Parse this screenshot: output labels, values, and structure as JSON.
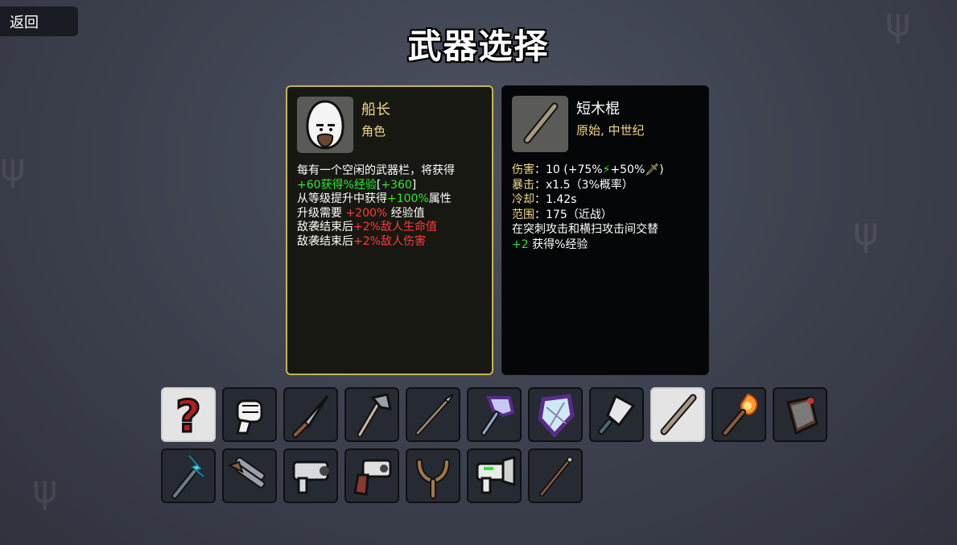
{
  "back_label": "返回",
  "title": "武器选择",
  "character": {
    "name": "船长",
    "type": "角色",
    "lines": [
      [
        {
          "t": "每有一个空闲的武器栏，将获得",
          "c": "w"
        }
      ],
      [
        {
          "t": "+60获得%经验",
          "c": "g"
        },
        {
          "t": "[",
          "c": "w"
        },
        {
          "t": "+360",
          "c": "g"
        },
        {
          "t": "]",
          "c": "w"
        }
      ],
      [
        {
          "t": "从等级提升中获得",
          "c": "w"
        },
        {
          "t": "+100%",
          "c": "g"
        },
        {
          "t": "属性",
          "c": "w"
        }
      ],
      [
        {
          "t": "升级需要 ",
          "c": "w"
        },
        {
          "t": "+200%",
          "c": "r"
        },
        {
          "t": " 经验值",
          "c": "w"
        }
      ],
      [
        {
          "t": "敌袭结束后",
          "c": "w"
        },
        {
          "t": "+2%敌人生命值",
          "c": "r"
        }
      ],
      [
        {
          "t": "敌袭结束后",
          "c": "w"
        },
        {
          "t": "+2%敌人伤害",
          "c": "r"
        }
      ]
    ]
  },
  "weapon": {
    "name": "短木棍",
    "tags": "原始, 中世纪",
    "lines": [
      [
        {
          "t": "伤害",
          "c": "gold"
        },
        {
          "t": "：10 (+75%",
          "c": "w"
        },
        {
          "t": "⚡",
          "c": "g"
        },
        {
          "t": "+50%",
          "c": "w"
        },
        {
          "t": "🗡",
          "c": "gold"
        },
        {
          "t": ")",
          "c": "w"
        }
      ],
      [
        {
          "t": "暴击",
          "c": "gold"
        },
        {
          "t": "：x1.5（3%概率）",
          "c": "w"
        }
      ],
      [
        {
          "t": "冷却",
          "c": "gold"
        },
        {
          "t": "：1.42s",
          "c": "w"
        }
      ],
      [
        {
          "t": "范围",
          "c": "gold"
        },
        {
          "t": "：175（近战）",
          "c": "w"
        }
      ],
      [
        {
          "t": "在突刺攻击和横扫攻击间交替",
          "c": "w"
        }
      ],
      [
        {
          "t": "+2",
          "c": "g"
        },
        {
          "t": " 获得%经验",
          "c": "w"
        }
      ]
    ]
  },
  "weapon_slots": [
    {
      "icon": "random-question-icon",
      "selected": true
    },
    {
      "icon": "fist-icon"
    },
    {
      "icon": "knife-icon"
    },
    {
      "icon": "axe-icon"
    },
    {
      "icon": "spear-icon"
    },
    {
      "icon": "purple-hammer-icon"
    },
    {
      "icon": "crystal-shield-icon"
    },
    {
      "icon": "cleaver-icon"
    },
    {
      "icon": "short-stick-icon",
      "selected": true
    },
    {
      "icon": "torch-icon"
    },
    {
      "icon": "chainsaw-icon"
    },
    {
      "icon": "lightning-staff-icon"
    },
    {
      "icon": "double-barrel-shotgun-icon"
    },
    {
      "icon": "smg-icon"
    },
    {
      "icon": "revolver-icon"
    },
    {
      "icon": "slingshot-icon"
    },
    {
      "icon": "taser-gun-icon"
    },
    {
      "icon": "wand-icon"
    }
  ],
  "colors": {
    "green": "#2ee62e",
    "red": "#ff3a3a",
    "gold": "#f0d888",
    "char_border": "#c7b54c"
  }
}
